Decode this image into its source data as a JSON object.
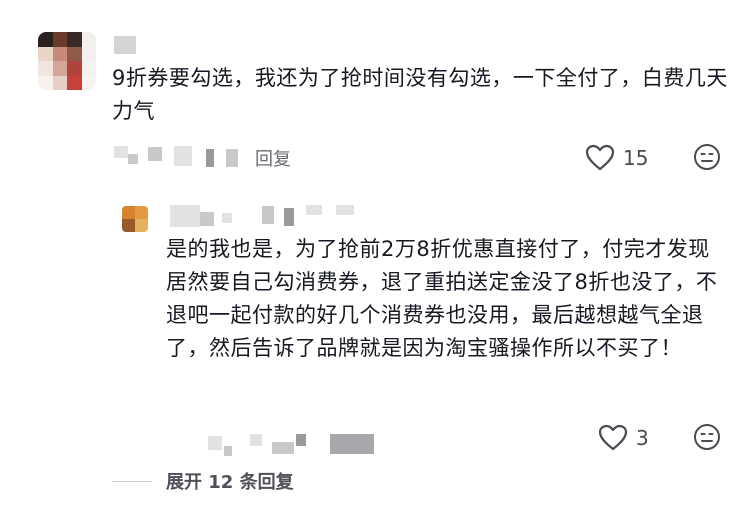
{
  "comment": {
    "text": "9折券要勾选，我还为了抢时间没有勾选，一下全付了，白费几天力气",
    "reply_label": "回复",
    "like_count": "15"
  },
  "reply": {
    "text": "是的我也是，为了抢前2万8折优惠直接付了，付完才发现居然要自己勾消费券，退了重拍送定金没了8折也没了，不退吧一起付款的好几个消费券也没用，最后越想越气全退了，然后告诉了品牌就是因为淘宝骚操作所以不买了！",
    "like_count": "3"
  },
  "expand_label": "展开 12 条回复",
  "icons": {
    "like": "heart-outline-icon",
    "emoji": "emoji-icon"
  }
}
